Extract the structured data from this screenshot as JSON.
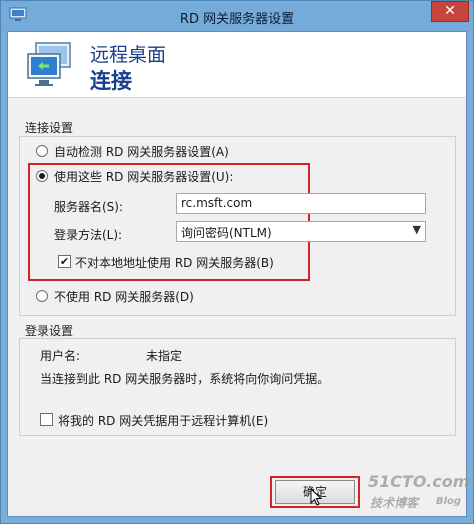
{
  "window": {
    "title": "RD 网关服务器设置",
    "close_glyph": "✕"
  },
  "header": {
    "subtitle": "远程桌面",
    "title": "连接",
    "icon": "remote-desktop-icon"
  },
  "connection_settings": {
    "group_label": "连接设置",
    "auto_detect_label": "自动检测 RD 网关服务器设置(A)",
    "use_these_label": "使用这些 RD 网关服务器设置(U):",
    "server_name_label": "服务器名(S):",
    "server_name_value": "rc.msft.com",
    "logon_method_label": "登录方法(L):",
    "logon_method_value": "询问密码(NTLM)",
    "bypass_local_label": "不对本地地址使用 RD 网关服务器(B)",
    "bypass_local_checked": true,
    "no_gateway_label": "不使用 RD 网关服务器(D)",
    "selected_option": "use_these"
  },
  "logon_settings": {
    "group_label": "登录设置",
    "username_label": "用户名:",
    "username_value": "未指定",
    "info_text": "当连接到此 RD 网关服务器时，系统将向你询问凭据。",
    "use_credentials_label": "将我的 RD 网关凭据用于远程计算机(E)",
    "use_credentials_checked": false
  },
  "footer": {
    "ok_label": "确定"
  },
  "watermark": {
    "line1": "51CTO.com",
    "line2": "技术博客",
    "line3": "Blog"
  },
  "colors": {
    "highlight": "#d12525",
    "titlebar": "#75abd8",
    "close": "#c7463b",
    "header_text": "#173d8f"
  }
}
